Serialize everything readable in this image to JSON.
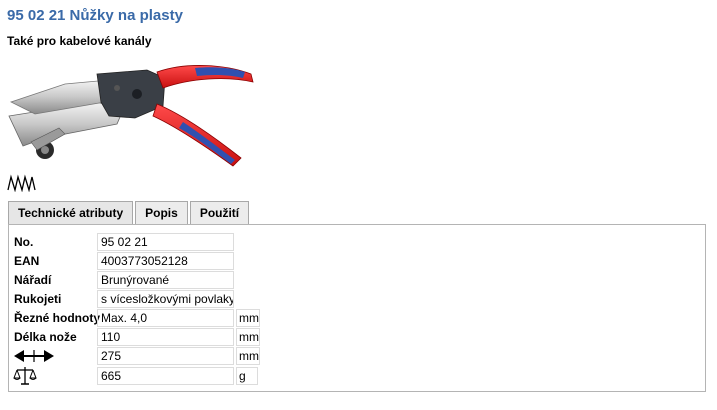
{
  "product": {
    "title": "95 02 21 Nůžky na plasty",
    "subtitle": "Také pro kabelové kanály"
  },
  "colors": {
    "title": "#3a6aa8",
    "handle_red": "#e02020",
    "handle_blue": "#3050b0"
  },
  "icons": {
    "blade_type": "serrated-blade-icon",
    "length": "double-arrow-icon",
    "weight": "scale-icon"
  },
  "tabs": [
    {
      "label": "Technické atributy",
      "active": true
    },
    {
      "label": "Popis",
      "active": false
    },
    {
      "label": "Použití",
      "active": false
    }
  ],
  "attributes": [
    {
      "label": "No.",
      "value": "95 02 21",
      "unit": ""
    },
    {
      "label": "EAN",
      "value": "4003773052128",
      "unit": ""
    },
    {
      "label": "Nářadí",
      "value": "Brunýrované",
      "unit": ""
    },
    {
      "label": "Rukojeti",
      "value": "s vícesložkovými povlaky",
      "unit": ""
    },
    {
      "label": "Řezné hodnoty",
      "value": "Max. 4,0",
      "unit": "mm"
    },
    {
      "label": "Délka nože",
      "value": "110",
      "unit": "mm"
    },
    {
      "label": "",
      "value": "275",
      "unit": "mm"
    },
    {
      "label": "",
      "value": "665",
      "unit": "g"
    }
  ]
}
